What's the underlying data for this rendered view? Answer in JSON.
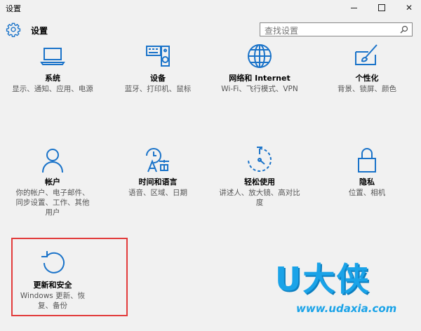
{
  "window": {
    "title": "设置",
    "min_icon": "minimize-icon",
    "max_icon": "maximize-icon",
    "close_glyph": "✕"
  },
  "header": {
    "title": "设置",
    "icon": "gear-icon"
  },
  "search": {
    "placeholder": "查找设置",
    "icon": "search-icon"
  },
  "accent_color": "#1a73c9",
  "tiles": [
    {
      "name": "系统",
      "desc": "显示、通知、应用、电源",
      "icon": "laptop-icon"
    },
    {
      "name": "设备",
      "desc": "蓝牙、打印机、鼠标",
      "icon": "keyboard-speaker-icon"
    },
    {
      "name": "网络和 Internet",
      "desc": "Wi-Fi、飞行模式、VPN",
      "icon": "globe-icon"
    },
    {
      "name": "个性化",
      "desc": "背景、锁屏、颜色",
      "icon": "paint-icon"
    },
    {
      "name": "帐户",
      "desc": "你的帐户、电子邮件、同步设置、工作、其他用户",
      "icon": "person-icon"
    },
    {
      "name": "时间和语言",
      "desc": "语音、区域、日期",
      "icon": "time-language-icon"
    },
    {
      "name": "轻松使用",
      "desc": "讲述人、放大镜、高对比度",
      "icon": "ease-of-access-icon"
    },
    {
      "name": "隐私",
      "desc": "位置、相机",
      "icon": "lock-icon"
    },
    {
      "name": "更新和安全",
      "desc": "Windows 更新、恢复、备份",
      "icon": "update-icon"
    }
  ],
  "highlight_color": "#e23b3b",
  "watermark": {
    "text": "U大侠",
    "url": "www.udaxia.com",
    "color": "#1aa3e8"
  }
}
